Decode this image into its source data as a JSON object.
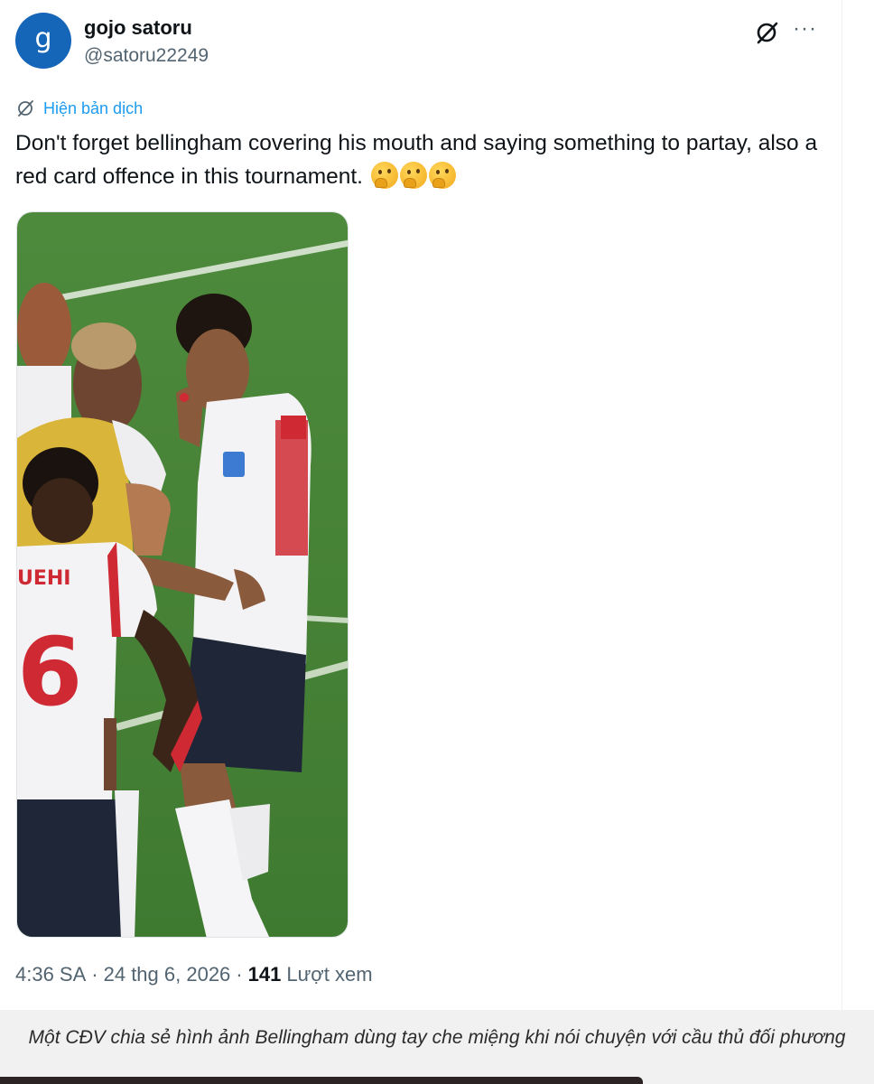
{
  "tweet": {
    "avatar_letter": "g",
    "display_name": "gojo satoru",
    "handle": "@satoru22249",
    "more_label": "···",
    "translate_label": "Hiện bản dịch",
    "text": "Don't forget bellingham covering his mouth and saying something to partay, also a red card offence in this tournament.",
    "emojis": [
      "thinking-face-emoji",
      "thinking-face-emoji",
      "thinking-face-emoji"
    ],
    "media_description_icon": "photo",
    "time": "4:36 SA",
    "separator": "·",
    "date": "24 thg 6, 2026",
    "views_count": "141",
    "views_label": "Lượt xem"
  },
  "caption": {
    "text": "Một CĐV chia sẻ hình ảnh Bellingham dùng tay che miệng khi nói chuyện với cầu thủ đối phương"
  },
  "photo": {
    "player_name_left": "UEHI",
    "player_number_left": "6"
  },
  "colors": {
    "avatar": "#1565b9",
    "link": "#1d9bf0",
    "muted": "#536471",
    "pitch": "#4f8a3f",
    "kit_white": "#f3f3f5",
    "shorts_navy": "#1e2637",
    "kit_yellow": "#d9b53a",
    "kit_red": "#cf2a34"
  }
}
